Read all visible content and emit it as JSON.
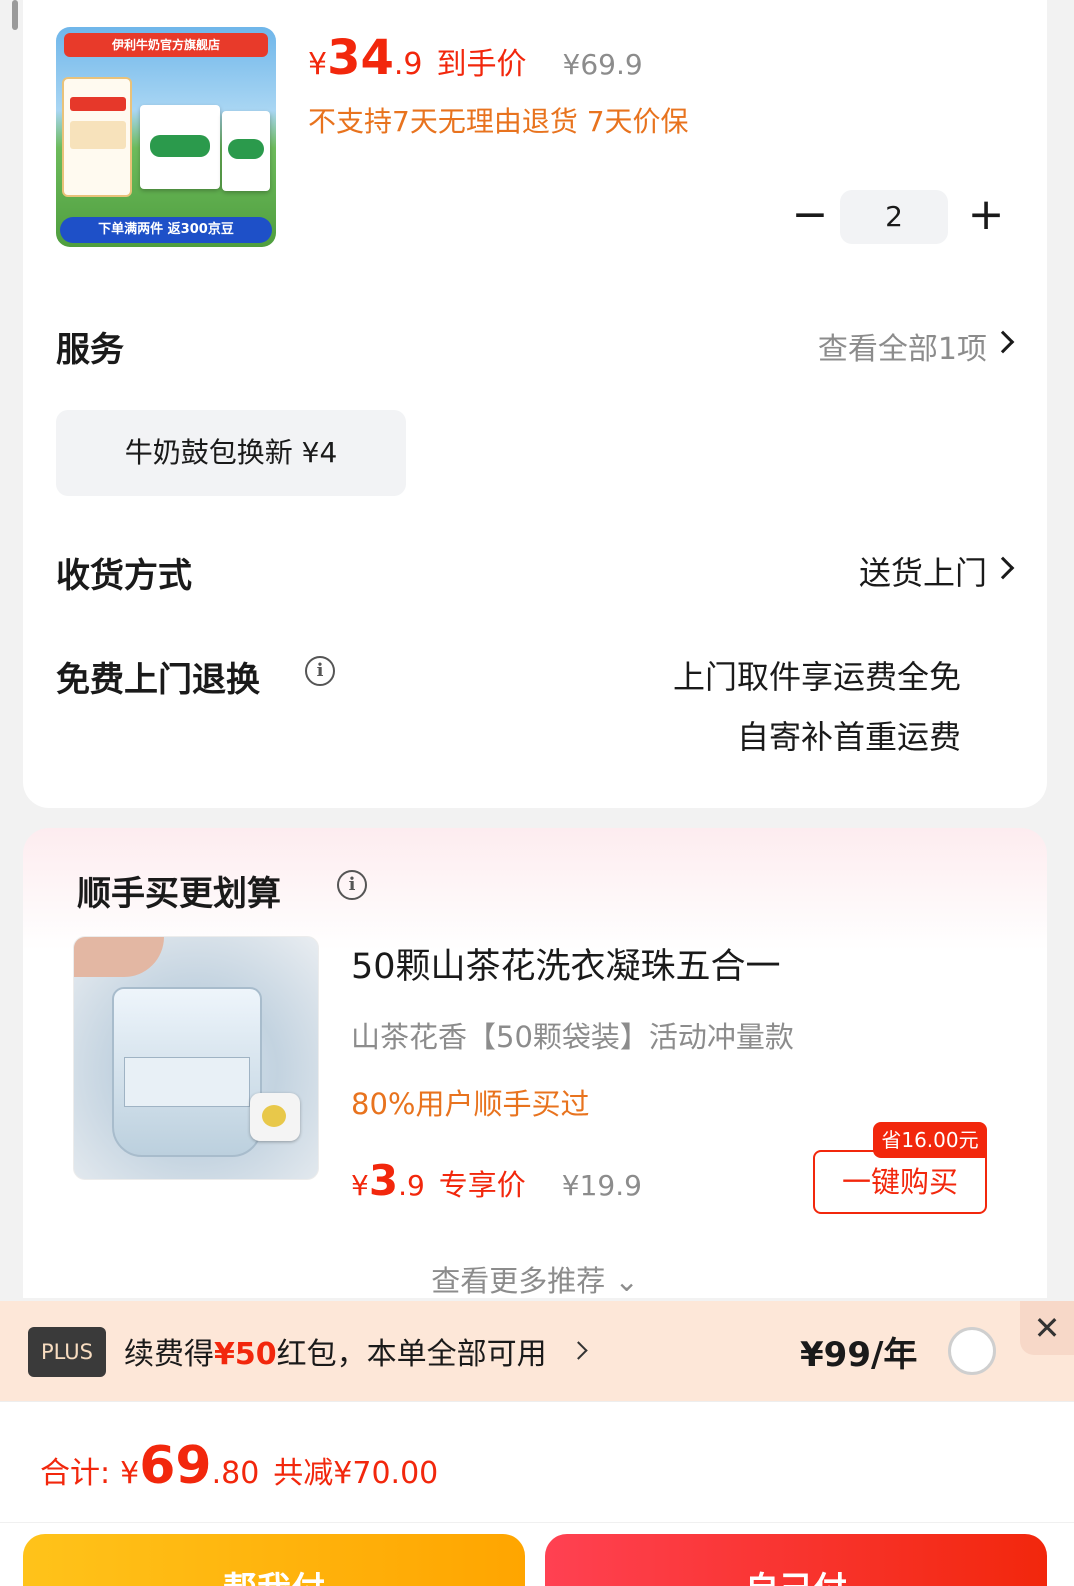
{
  "product": {
    "image_banner_text": "伊利牛奶官方旗舰店",
    "image_bottom_text": "下单满两件 返300京豆",
    "price_symbol": "¥",
    "price_integer": "34",
    "price_decimal": ".9",
    "price_tag": "到手价",
    "original_price": "¥69.9",
    "policy": "不支持7天无理由退货  7天价保",
    "quantity": "2",
    "minus_label": "−",
    "plus_label": "+"
  },
  "service": {
    "label": "服务",
    "view_all": "查看全部1项",
    "chip": "牛奶鼓包换新  ¥4"
  },
  "delivery": {
    "label": "收货方式",
    "value": "送货上门"
  },
  "free_return": {
    "label": "免费上门退换",
    "line1": "上门取件享运费全免",
    "line2": "自寄补首重运费"
  },
  "recommend": {
    "title": "顺手买更划算",
    "name": "50颗山茶花洗衣凝珠五合一",
    "spec": "山茶花香【50颗袋装】活动冲量款",
    "bought": "80%用户顺手买过",
    "price_symbol": "¥",
    "price_integer": "3",
    "price_decimal": ".9",
    "price_tag": "专享价",
    "original_price": "¥19.9",
    "save_tag": "省16.00元",
    "buy_button": "一键购买",
    "more": "查看更多推荐 ⌄"
  },
  "plus": {
    "badge": "PLUS",
    "text_prefix": "续费得",
    "text_highlight": "¥50",
    "text_suffix": "红包，本单全部可用",
    "price": "¥99/年",
    "close": "✕"
  },
  "total": {
    "label": "合计:",
    "symbol": "¥",
    "integer": "69",
    "decimal": ".80",
    "saved": "共减¥70.00",
    "help_pay": "帮我付",
    "self_pay": "自己付"
  },
  "colors": {
    "accent_red": "#f2270c",
    "accent_orange": "#e8731e",
    "help_pay_yellow": "#ffb30f"
  }
}
